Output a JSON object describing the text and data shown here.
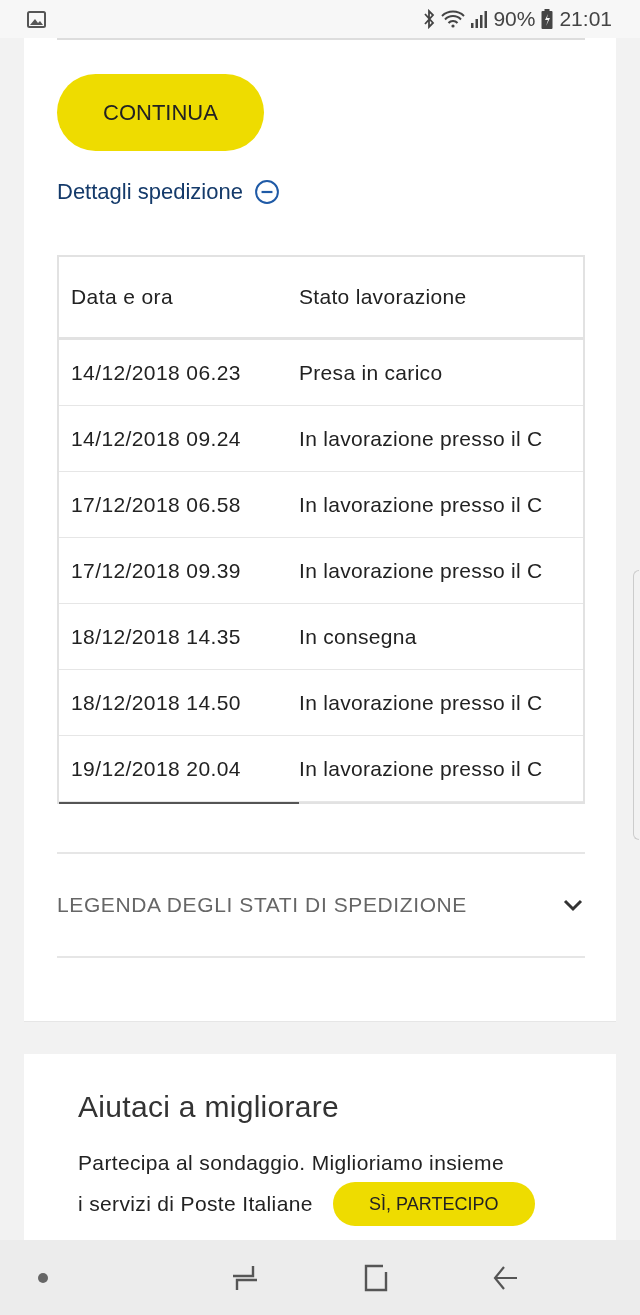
{
  "status_bar": {
    "battery": "90%",
    "time": "21:01"
  },
  "continue_button": {
    "label": "CONTINUA"
  },
  "details_toggle": {
    "label": "Dettagli spedizione",
    "expanded": true
  },
  "table": {
    "columns": [
      "Data e ora",
      "Stato lavorazione"
    ],
    "rows": [
      {
        "date": "14/12/2018 06.23",
        "status": "Presa in carico"
      },
      {
        "date": "14/12/2018 09.24",
        "status": "In lavorazione presso il C"
      },
      {
        "date": "17/12/2018 06.58",
        "status": "In lavorazione presso il C"
      },
      {
        "date": "17/12/2018 09.39",
        "status": "In lavorazione presso il C"
      },
      {
        "date": "18/12/2018 14.35",
        "status": "In consegna"
      },
      {
        "date": "18/12/2018 14.50",
        "status": "In lavorazione presso il C"
      },
      {
        "date": "19/12/2018 20.04",
        "status": "In lavorazione presso il C"
      }
    ]
  },
  "legend": {
    "label": "LEGENDA DEGLI STATI DI SPEDIZIONE",
    "expanded": false
  },
  "survey": {
    "title": "Aiutaci a migliorare",
    "text_lines": [
      "Partecipa al sondaggio. Miglioriamo insieme",
      "i servizi di Poste Italiane"
    ],
    "button": "SÌ, PARTECIPO"
  }
}
